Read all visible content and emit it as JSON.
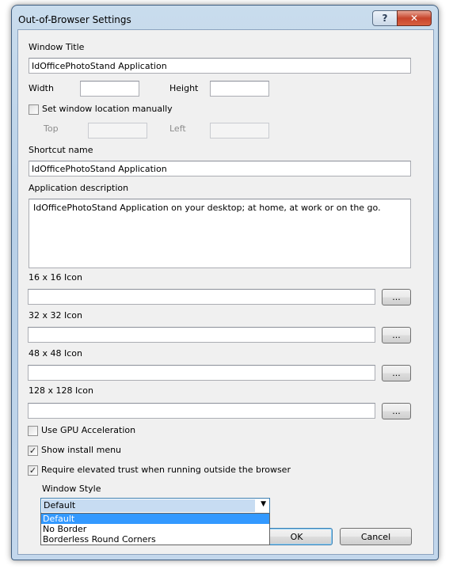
{
  "window": {
    "title": "Out-of-Browser Settings",
    "help_label": "?",
    "close_label": "✕"
  },
  "form": {
    "window_title_label": "Window Title",
    "window_title_value": "IdOfficePhotoStand Application",
    "width_label": "Width",
    "height_label": "Height",
    "width_value": "",
    "height_value": "",
    "set_location_label": "Set window location manually",
    "set_location_checked": false,
    "top_label": "Top",
    "left_label": "Left",
    "top_value": "",
    "left_value": "",
    "shortcut_label": "Shortcut name",
    "shortcut_value": "IdOfficePhotoStand Application",
    "description_label": "Application description",
    "description_value": "IdOfficePhotoStand Application on your desktop; at home, at work or on the go.",
    "icon16_label": "16 x 16 Icon",
    "icon32_label": "32 x 32 Icon",
    "icon48_label": "48 x 48 Icon",
    "icon128_label": "128 x 128 Icon",
    "browse_label": "...",
    "gpu_label": "Use GPU Acceleration",
    "gpu_checked": false,
    "install_menu_label": "Show install menu",
    "install_menu_checked": true,
    "elevated_label": "Require elevated trust when running outside the browser",
    "elevated_checked": true,
    "window_style_label": "Window Style",
    "window_style_value": "Default",
    "window_style_options": [
      "Default",
      "No Border",
      "Borderless Round Corners"
    ]
  },
  "buttons": {
    "ok_label": "OK",
    "cancel_label": "Cancel"
  },
  "check_mark": "✓"
}
